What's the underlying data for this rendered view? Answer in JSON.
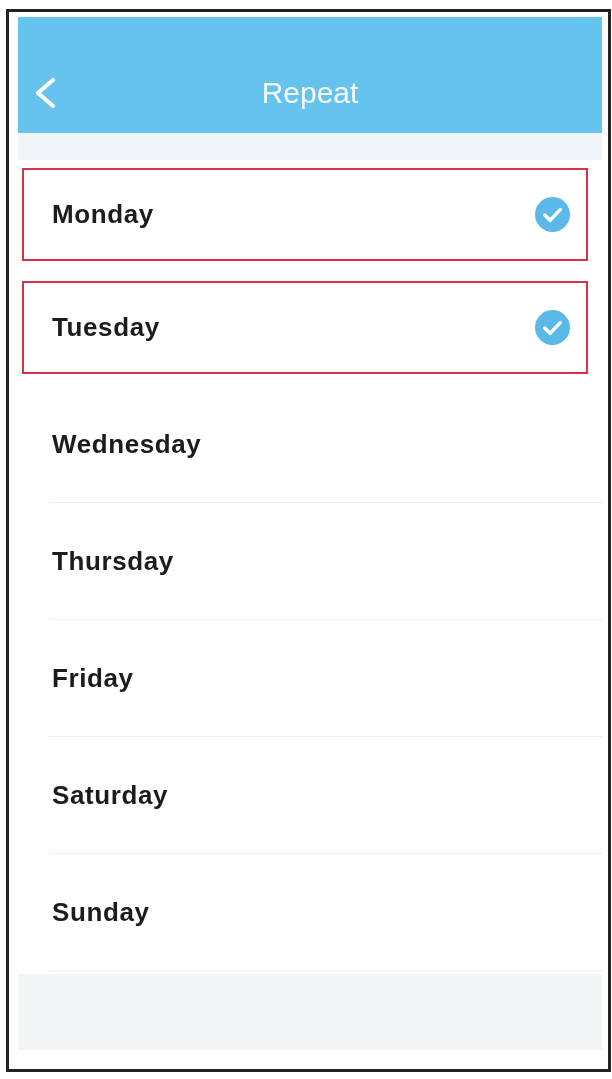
{
  "header": {
    "title": "Repeat"
  },
  "days": [
    {
      "label": "Monday",
      "selected": true
    },
    {
      "label": "Tuesday",
      "selected": true
    },
    {
      "label": "Wednesday",
      "selected": false
    },
    {
      "label": "Thursday",
      "selected": false
    },
    {
      "label": "Friday",
      "selected": false
    },
    {
      "label": "Saturday",
      "selected": false
    },
    {
      "label": "Sunday",
      "selected": false
    }
  ]
}
